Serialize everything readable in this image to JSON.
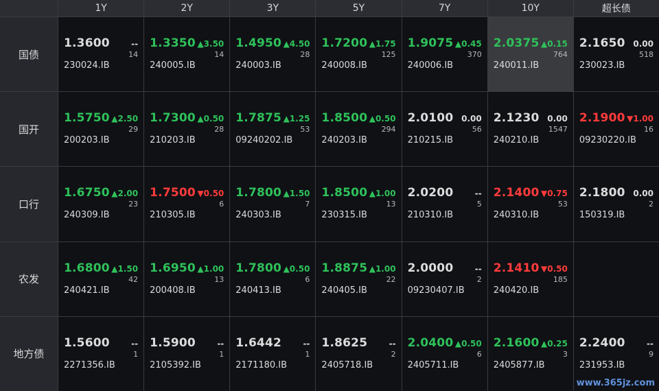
{
  "columns": [
    "1Y",
    "2Y",
    "3Y",
    "5Y",
    "7Y",
    "10Y",
    "超长债"
  ],
  "rows": [
    {
      "label": "国债",
      "cells": [
        {
          "yield": "1.3600",
          "change": "--",
          "volume": "14",
          "code": "230024.IB",
          "dir": "flat"
        },
        {
          "yield": "1.3350",
          "change": "▲3.50",
          "volume": "14",
          "code": "240005.IB",
          "dir": "up"
        },
        {
          "yield": "1.4950",
          "change": "▲4.50",
          "volume": "28",
          "code": "240003.IB",
          "dir": "up"
        },
        {
          "yield": "1.7200",
          "change": "▲1.75",
          "volume": "125",
          "code": "240008.IB",
          "dir": "up"
        },
        {
          "yield": "1.9075",
          "change": "▲0.45",
          "volume": "370",
          "code": "240006.IB",
          "dir": "up"
        },
        {
          "yield": "2.0375",
          "change": "▲0.15",
          "volume": "764",
          "code": "240011.IB",
          "dir": "up",
          "highlight": true
        },
        {
          "yield": "2.1650",
          "change": "0.00",
          "volume": "518",
          "code": "230023.IB",
          "dir": "flat"
        }
      ]
    },
    {
      "label": "国开",
      "cells": [
        {
          "yield": "1.5750",
          "change": "▲2.50",
          "volume": "29",
          "code": "200203.IB",
          "dir": "up"
        },
        {
          "yield": "1.7300",
          "change": "▲0.50",
          "volume": "28",
          "code": "210203.IB",
          "dir": "up"
        },
        {
          "yield": "1.7875",
          "change": "▲1.25",
          "volume": "53",
          "code": "09240202.IB",
          "dir": "up"
        },
        {
          "yield": "1.8500",
          "change": "▲0.50",
          "volume": "294",
          "code": "240203.IB",
          "dir": "up"
        },
        {
          "yield": "2.0100",
          "change": "0.00",
          "volume": "56",
          "code": "210215.IB",
          "dir": "flat"
        },
        {
          "yield": "2.1230",
          "change": "0.00",
          "volume": "1547",
          "code": "240210.IB",
          "dir": "flat"
        },
        {
          "yield": "2.1900",
          "change": "▼1.00",
          "volume": "16",
          "code": "09230220.IB",
          "dir": "down"
        }
      ]
    },
    {
      "label": "口行",
      "cells": [
        {
          "yield": "1.6750",
          "change": "▲2.00",
          "volume": "23",
          "code": "240309.IB",
          "dir": "up"
        },
        {
          "yield": "1.7500",
          "change": "▼0.50",
          "volume": "6",
          "code": "210305.IB",
          "dir": "down"
        },
        {
          "yield": "1.7800",
          "change": "▲1.50",
          "volume": "7",
          "code": "240303.IB",
          "dir": "up"
        },
        {
          "yield": "1.8500",
          "change": "▲1.00",
          "volume": "13",
          "code": "230315.IB",
          "dir": "up"
        },
        {
          "yield": "2.0200",
          "change": "--",
          "volume": "5",
          "code": "210310.IB",
          "dir": "flat"
        },
        {
          "yield": "2.1400",
          "change": "▼0.75",
          "volume": "53",
          "code": "240310.IB",
          "dir": "down"
        },
        {
          "yield": "2.1800",
          "change": "0.00",
          "volume": "2",
          "code": "150319.IB",
          "dir": "flat"
        }
      ]
    },
    {
      "label": "农发",
      "cells": [
        {
          "yield": "1.6800",
          "change": "▲1.50",
          "volume": "42",
          "code": "240421.IB",
          "dir": "up"
        },
        {
          "yield": "1.6950",
          "change": "▲1.00",
          "volume": "13",
          "code": "200408.IB",
          "dir": "up"
        },
        {
          "yield": "1.7800",
          "change": "▲0.50",
          "volume": "6",
          "code": "240413.IB",
          "dir": "up"
        },
        {
          "yield": "1.8875",
          "change": "▲1.00",
          "volume": "22",
          "code": "240405.IB",
          "dir": "up"
        },
        {
          "yield": "2.0000",
          "change": "--",
          "volume": "2",
          "code": "09230407.IB",
          "dir": "flat"
        },
        {
          "yield": "2.1410",
          "change": "▼0.50",
          "volume": "185",
          "code": "240420.IB",
          "dir": "down"
        },
        {
          "empty": true
        }
      ]
    },
    {
      "label": "地方债",
      "cells": [
        {
          "yield": "1.5600",
          "change": "--",
          "volume": "1",
          "code": "2271356.IB",
          "dir": "flat"
        },
        {
          "yield": "1.5900",
          "change": "--",
          "volume": "1",
          "code": "2105392.IB",
          "dir": "flat"
        },
        {
          "yield": "1.6442",
          "change": "--",
          "volume": "1",
          "code": "2171180.IB",
          "dir": "flat"
        },
        {
          "yield": "1.8625",
          "change": "--",
          "volume": "2",
          "code": "2405718.IB",
          "dir": "flat"
        },
        {
          "yield": "2.0400",
          "change": "▲0.50",
          "volume": "6",
          "code": "2405711.IB",
          "dir": "up"
        },
        {
          "yield": "2.1600",
          "change": "▲0.25",
          "volume": "3",
          "code": "2405877.IB",
          "dir": "up"
        },
        {
          "yield": "2.2400",
          "change": "--",
          "volume": "9",
          "code": "231953.IB",
          "dir": "flat"
        }
      ]
    }
  ],
  "watermark": "www.365jz.com",
  "colors": {
    "up": "#2fc15a",
    "down": "#ff3b3b",
    "flat": "#dcdcdc",
    "highlight": "#3a3b3f"
  }
}
